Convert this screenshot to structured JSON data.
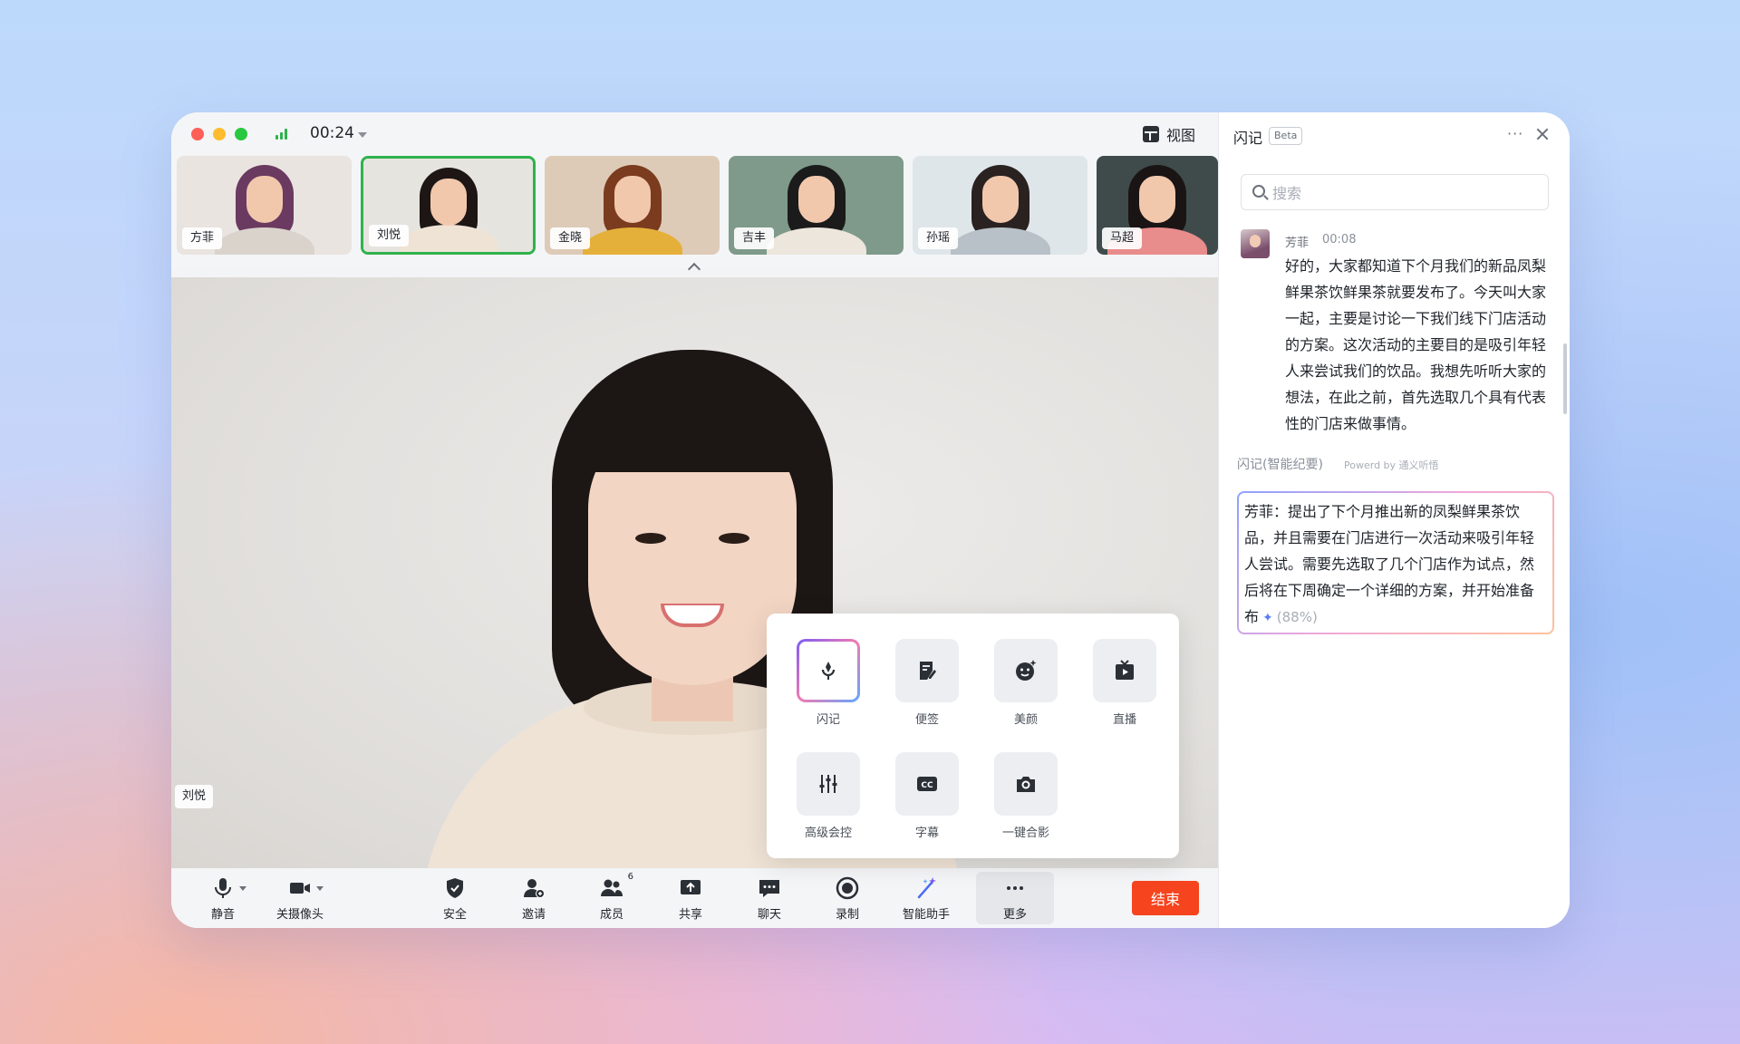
{
  "window": {
    "timer": "00:24",
    "view_label": "视图"
  },
  "participants": [
    {
      "name": "方菲",
      "active": false,
      "bg": "#e9e4df",
      "hair": "#6b3a60",
      "body": "#d9d3cc"
    },
    {
      "name": "刘悦",
      "active": true,
      "bg": "#e6e4df",
      "hair": "#1d1614",
      "body": "#efe3d6"
    },
    {
      "name": "金晓",
      "active": false,
      "bg": "#ddcbb8",
      "hair": "#7a3b1f",
      "body": "#e5b03a"
    },
    {
      "name": "吉丰",
      "active": false,
      "bg": "#7f9a8a",
      "hair": "#1b1b1b",
      "body": "#ece6dc"
    },
    {
      "name": "孙瑶",
      "active": false,
      "bg": "#dfe6ea",
      "hair": "#2a2220",
      "body": "#b8c1c7"
    },
    {
      "name": "马超",
      "active": false,
      "bg": "#3f4b4a",
      "hair": "#1a1414",
      "body": "#e98c8c"
    }
  ],
  "main_video": {
    "name": "刘悦"
  },
  "toolbar": {
    "mute": "静音",
    "camera": "关摄像头",
    "security": "安全",
    "invite": "邀请",
    "members": "成员",
    "members_count": "6",
    "share": "共享",
    "chat": "聊天",
    "record": "录制",
    "assistant": "智能助手",
    "more": "更多",
    "end": "结束"
  },
  "more_menu": {
    "items": [
      {
        "label": "闪记"
      },
      {
        "label": "便签"
      },
      {
        "label": "美颜"
      },
      {
        "label": "直播"
      },
      {
        "label": "高级会控"
      },
      {
        "label": "字幕"
      },
      {
        "label": "一键合影"
      }
    ]
  },
  "panel": {
    "title": "闪记",
    "beta": "Beta",
    "search_placeholder": "搜索",
    "transcript": {
      "speaker": "芳菲",
      "time": "00:08",
      "text": "好的，大家都知道下个月我们的新品凤梨鲜果茶饮鲜果茶就要发布了。今天叫大家一起，主要是讨论一下我们线下门店活动的方案。这次活动的主要目的是吸引年轻人来尝试我们的饮品。我想先听听大家的想法，在此之前，首先选取几个具有代表性的门店来做事情。"
    },
    "summary": {
      "title": "闪记(智能纪要)",
      "powered": "Powerd by 通义听悟",
      "text": "芳菲：提出了下个月推出新的凤梨鲜果茶饮品，并且需要在门店进行一次活动来吸引年轻人尝试。需要先选取了几个门店作为试点，然后将在下周确定一个详细的方案，并开始准备布",
      "progress": "(88%)"
    }
  },
  "colors": {
    "active_border": "#2fb24c",
    "end_button": "#f5441e"
  }
}
